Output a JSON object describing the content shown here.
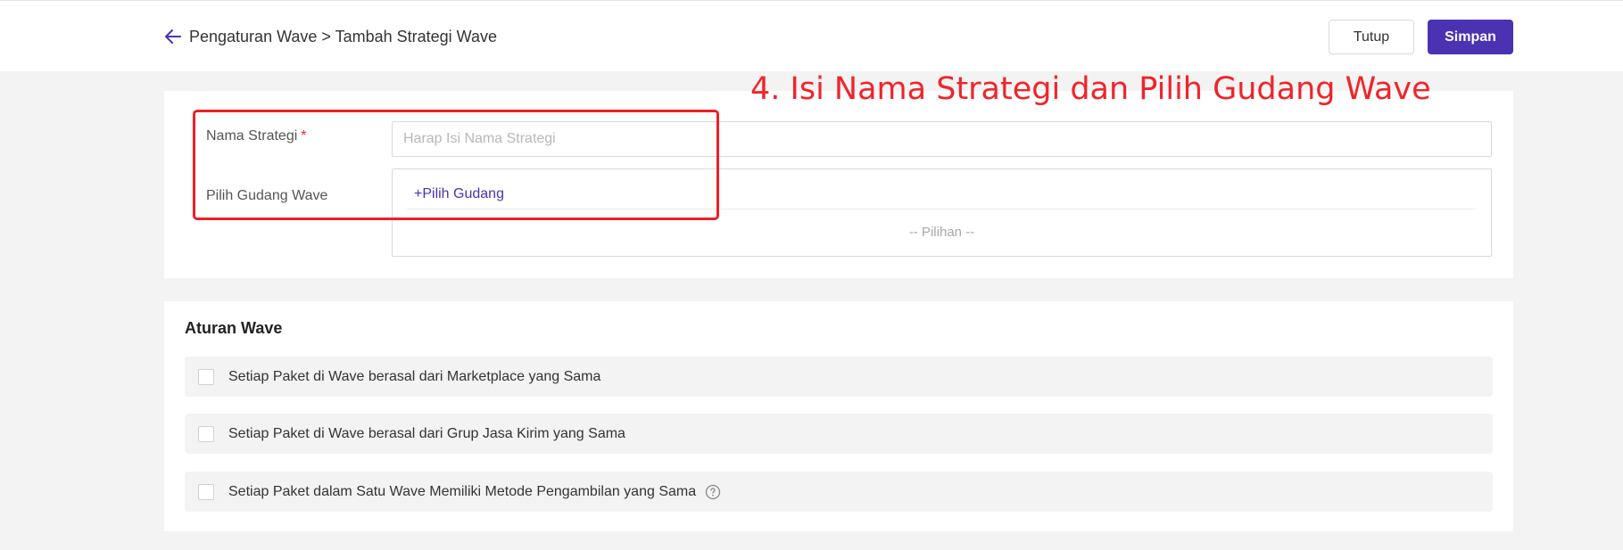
{
  "header": {
    "breadcrumb": "Pengaturan Wave > Tambah Strategi Wave",
    "close_label": "Tutup",
    "save_label": "Simpan"
  },
  "annotation": "4. Isi Nama Strategi dan Pilih Gudang Wave",
  "form": {
    "strategy_name_label": "Nama Strategi",
    "required_mark": "*",
    "strategy_name_placeholder": "Harap Isi Nama Strategi",
    "strategy_name_value": "",
    "warehouse_label": "Pilih Gudang Wave",
    "pick_warehouse_link": "+Pilih Gudang",
    "empty_text": "-- Pilihan --"
  },
  "rules": {
    "title": "Aturan Wave",
    "items": [
      {
        "label": "Setiap Paket di Wave berasal dari Marketplace yang Sama",
        "checked": false
      },
      {
        "label": "Setiap Paket di Wave berasal dari Grup Jasa Kirim yang Sama",
        "checked": false
      },
      {
        "label": "Setiap Paket dalam Satu Wave Memiliki Metode Pengambilan yang Sama",
        "checked": false
      }
    ]
  },
  "colors": {
    "accent": "#4b32b3",
    "annotation": "#f0242b",
    "required": "#e8282b"
  },
  "icons": {
    "back": "arrow-left-icon",
    "help": "question-circle-icon"
  }
}
